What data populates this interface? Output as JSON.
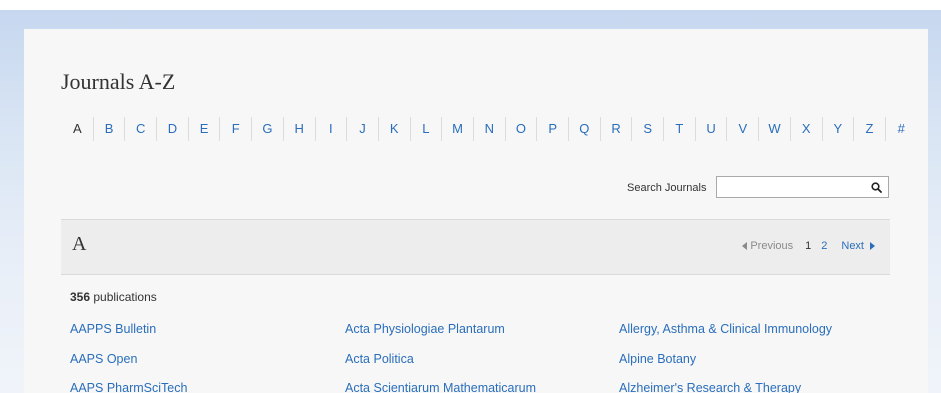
{
  "page": {
    "title": "Journals A-Z"
  },
  "alphabet": [
    "A",
    "B",
    "C",
    "D",
    "E",
    "F",
    "G",
    "H",
    "I",
    "J",
    "K",
    "L",
    "M",
    "N",
    "O",
    "P",
    "Q",
    "R",
    "S",
    "T",
    "U",
    "V",
    "W",
    "X",
    "Y",
    "Z",
    "#"
  ],
  "search": {
    "label": "Search Journals",
    "value": "",
    "icon": "search-icon"
  },
  "section": {
    "letter": "A"
  },
  "pagination": {
    "previous_label": "Previous",
    "pages": [
      "1",
      "2"
    ],
    "current_page": "1",
    "next_label": "Next"
  },
  "results": {
    "count": "356",
    "count_suffix": " publications"
  },
  "journals": {
    "column1": [
      "AAPPS Bulletin",
      "AAPS Open",
      "AAPS PharmSciTech"
    ],
    "column2": [
      "Acta Physiologiae Plantarum",
      "Acta Politica",
      "Acta Scientiarum Mathematicarum"
    ],
    "column3": [
      "Allergy, Asthma & Clinical Immunology",
      "Alpine Botany",
      "Alzheimer's Research & Therapy"
    ]
  },
  "colors": {
    "link": "#2a6ebb",
    "text": "#333333",
    "band": "#c6d7ef"
  }
}
